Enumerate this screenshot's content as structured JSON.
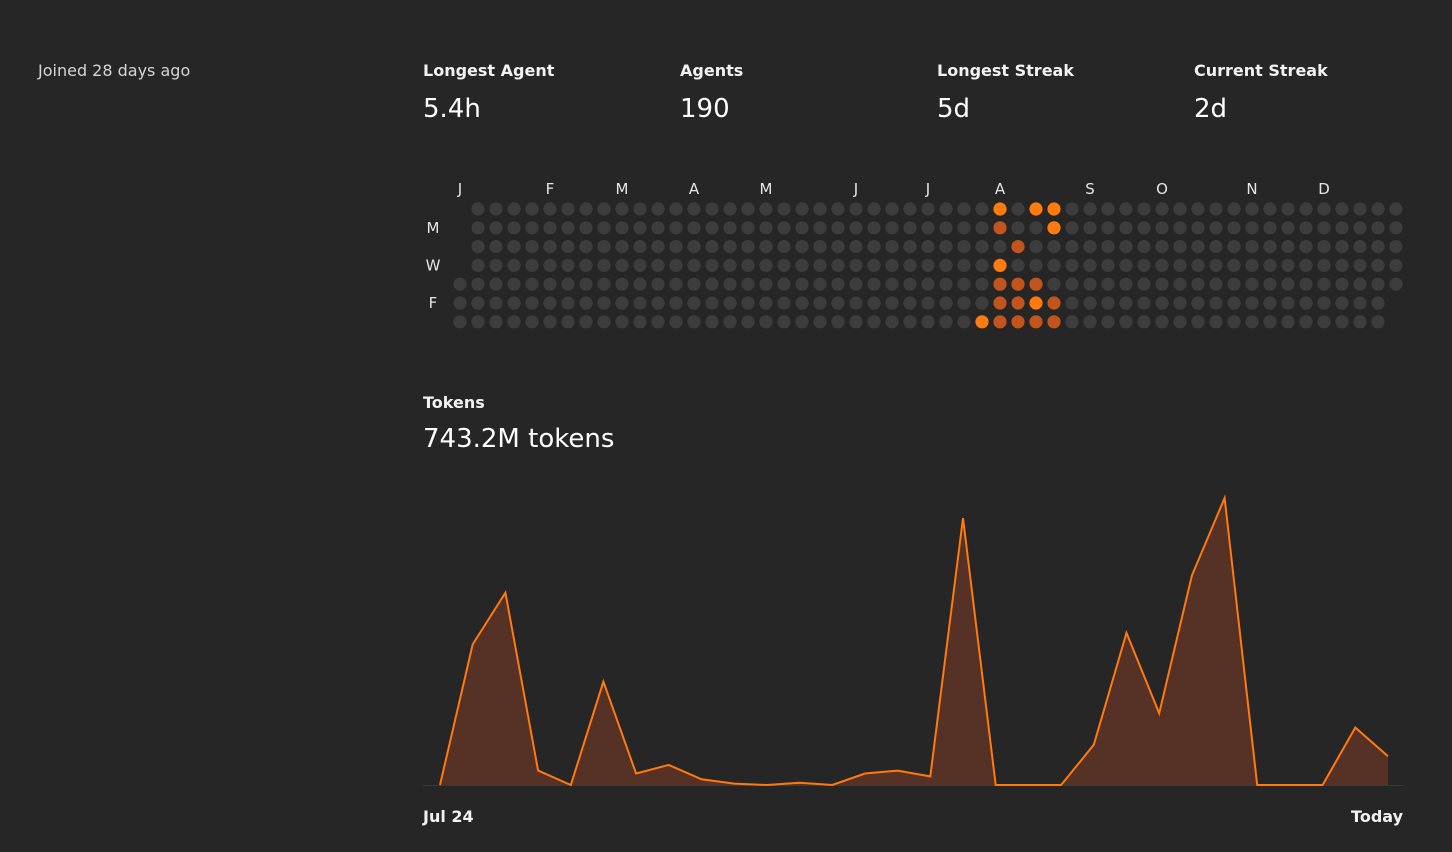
{
  "profile": {
    "joined": "Joined 28 days ago"
  },
  "stats": [
    {
      "label": "Longest Agent",
      "value": "5.4h"
    },
    {
      "label": "Agents",
      "value": "190"
    },
    {
      "label": "Longest Streak",
      "value": "5d"
    },
    {
      "label": "Current Streak",
      "value": "2d"
    }
  ],
  "heatmap": {
    "months": [
      "J",
      "F",
      "M",
      "A",
      "M",
      "J",
      "J",
      "A",
      "S",
      "O",
      "N",
      "D"
    ],
    "day_labels": [
      "M",
      "W",
      "F"
    ],
    "levels": {
      "0": "#3d3d3d",
      "1": "#c2541e",
      "2": "#ff7a0f"
    },
    "active_cells": [
      {
        "week": 30,
        "day": 0,
        "level": 2
      },
      {
        "week": 32,
        "day": 0,
        "level": 2
      },
      {
        "week": 33,
        "day": 0,
        "level": 2
      },
      {
        "week": 30,
        "day": 1,
        "level": 1
      },
      {
        "week": 33,
        "day": 1,
        "level": 2
      },
      {
        "week": 31,
        "day": 2,
        "level": 1
      },
      {
        "week": 30,
        "day": 3,
        "level": 2
      },
      {
        "week": 30,
        "day": 4,
        "level": 1
      },
      {
        "week": 31,
        "day": 4,
        "level": 1
      },
      {
        "week": 32,
        "day": 4,
        "level": 1
      },
      {
        "week": 30,
        "day": 5,
        "level": 1
      },
      {
        "week": 31,
        "day": 5,
        "level": 1
      },
      {
        "week": 32,
        "day": 5,
        "level": 2
      },
      {
        "week": 33,
        "day": 5,
        "level": 1
      },
      {
        "week": 29,
        "day": 6,
        "level": 2
      },
      {
        "week": 30,
        "day": 6,
        "level": 1
      },
      {
        "week": 31,
        "day": 6,
        "level": 1
      },
      {
        "week": 32,
        "day": 6,
        "level": 1
      },
      {
        "week": 33,
        "day": 6,
        "level": 1
      }
    ]
  },
  "tokens": {
    "label": "Tokens",
    "total": "743.2M tokens"
  },
  "chart_data": {
    "type": "area",
    "title": "",
    "xlabel": "",
    "ylabel": "",
    "x_range_labels": [
      "Jul 24",
      "Today"
    ],
    "values": [
      0,
      49,
      67,
      5,
      0,
      36,
      4,
      7,
      2,
      0.5,
      0,
      0.8,
      0,
      4,
      5,
      3,
      93,
      0,
      0,
      0,
      14,
      53,
      25,
      73,
      100,
      0,
      0,
      0,
      20,
      10
    ],
    "ylim": [
      0,
      100
    ],
    "line_color": "#ff7a0f",
    "fill_color": "#563125",
    "grid": false
  }
}
